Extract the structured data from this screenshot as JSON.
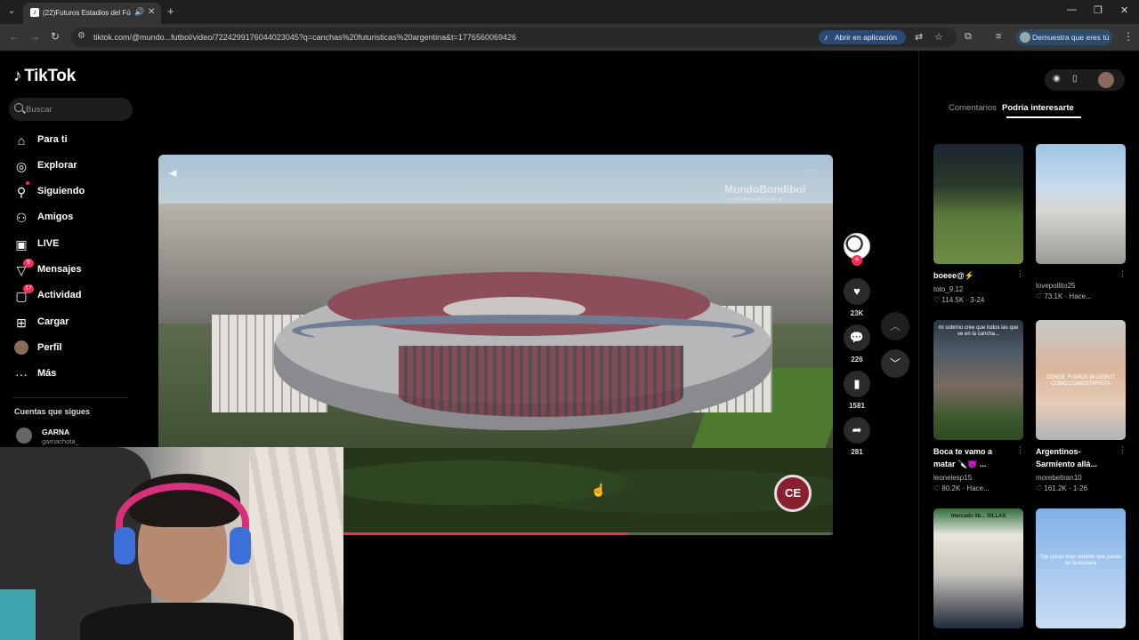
{
  "browser": {
    "tab_title": "(22)Futuros Estadios del Fú",
    "url": "tiktok.com/@mundo...futbol/video/7224299176044023045?q=canchas%20futuristicas%20argentina&t=1776560069426",
    "open_app": "Abrir en aplicación",
    "prove_human": "Demuestra que eres tú"
  },
  "sidebar": {
    "logo": "TikTok",
    "search_placeholder": "Buscar",
    "items": [
      {
        "label": "Para ti"
      },
      {
        "label": "Explorar"
      },
      {
        "label": "Siguiendo"
      },
      {
        "label": "Amigos"
      },
      {
        "label": "LIVE"
      },
      {
        "label": "Mensajes",
        "badge": "6"
      },
      {
        "label": "Actividad",
        "badge": "17"
      },
      {
        "label": "Cargar"
      },
      {
        "label": "Perfil"
      },
      {
        "label": "Más"
      }
    ],
    "following_title": "Cuentas que sigues",
    "following": [
      {
        "name": "GARNA",
        "handle": "garnachota_"
      }
    ]
  },
  "video": {
    "watermark": "MundoBondibol",
    "watermark_sub": "mundobondibol.com.ar",
    "progress": 0.58,
    "logo_text": "CE"
  },
  "actions": {
    "likes": "23K",
    "comments": "226",
    "saves": "1581",
    "shares": "281"
  },
  "right_panel": {
    "tabs": [
      "Comentarios",
      "Podría interesarte"
    ],
    "active_tab": "Podría interesarte",
    "cards": [
      {
        "title": "boeee@⚡",
        "user": "toto_9.12",
        "views": "114.5K",
        "date": "3-24"
      },
      {
        "title": "",
        "user": "lovepollito25",
        "views": "73.1K",
        "date": "Hace..."
      },
      {
        "title": "Boca te vamo a matar 🔪😈 ...",
        "user": "leonelesp15",
        "views": "80.2K",
        "date": "Hace...",
        "overlay": "mi sobrino cree que todos las que ve en la cancha..."
      },
      {
        "title": "Argentinos-Sarmiento allá...",
        "user": "morebeltran10",
        "views": "161.2K",
        "date": "1-26",
        "overlay": "DONDE FUIMOS MI DEBUT COMO COMENTARISTA"
      },
      {
        "title": "",
        "user": "",
        "views": "",
        "date": "",
        "overlay": "mercado lib... SILLAS"
      },
      {
        "title": "",
        "user": "",
        "views": "",
        "date": "",
        "overlay": "Top cosas mas random que pasan en la escuela"
      }
    ]
  },
  "colors": {
    "accent": "#fe2c55",
    "background": "#000000"
  }
}
